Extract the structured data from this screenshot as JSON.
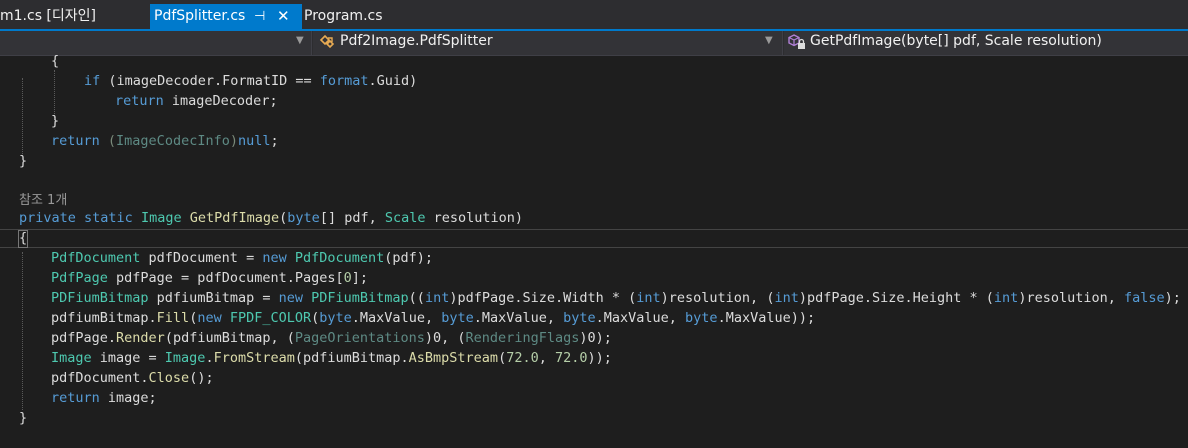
{
  "tabs": [
    {
      "label": "m1.cs [디자인]",
      "active": false
    },
    {
      "label": "PdfSplitter.cs",
      "active": true
    },
    {
      "label": "Program.cs",
      "active": false
    }
  ],
  "tab_pin_glyph": "⊣",
  "tab_close_glyph": "✕",
  "navbar": {
    "namespace_label": "Pdf2Image.PdfSplitter",
    "member_label": "GetPdfImage(byte[] pdf, Scale resolution)"
  },
  "icons": {
    "class_icon": "class-icon",
    "method_icon": "private-method-icon",
    "dropdown": "chevron-down-icon"
  },
  "colors": {
    "background": "#1e1e1e",
    "accent": "#007acc",
    "keyword": "#569cd6",
    "type": "#4ec9b0",
    "method": "#dcdcaa",
    "number": "#b5cea8",
    "text": "#dcdcdc",
    "codelens": "#999999"
  },
  "codelens": "참조 1개",
  "code": {
    "l1_brace": "{",
    "l2_if": "if",
    "l2_rest": " (imageDecoder.FormatID == ",
    "l2_format": "format",
    "l2_end": ".Guid)",
    "l3_return": "return",
    "l3_rest": " imageDecoder;",
    "l4_brace": "}",
    "l5_return": "return",
    "l5_cast_open": " (",
    "l5_type": "ImageCodecInfo",
    "l5_cast_close": ")",
    "l5_null": "null",
    "l5_end": ";",
    "l6_brace": "}",
    "sig_private": "private",
    "sig_static": "static",
    "sig_image": "Image",
    "sig_name": "GetPdfImage",
    "sig_open": "(",
    "sig_byte": "byte",
    "sig_mid": "[] pdf, ",
    "sig_scale": "Scale",
    "sig_end": " resolution)",
    "body_open": "{",
    "b1_t1": "PdfDocument",
    "b1_a": " pdfDocument = ",
    "b1_new": "new",
    "b1_t2": "PdfDocument",
    "b1_b": "(pdf);",
    "b2_t1": "PdfPage",
    "b2_a": " pdfPage = pdfDocument.Pages[",
    "b2_n": "0",
    "b2_b": "];",
    "b3_t1": "PDFiumBitmap",
    "b3_a": " pdfiumBitmap = ",
    "b3_new": "new",
    "b3_t2": "PDFiumBitmap",
    "b3_b": "((",
    "b3_int1": "int",
    "b3_c": ")pdfPage.Size.Width * (",
    "b3_int2": "int",
    "b3_d": ")resolution, (",
    "b3_int3": "int",
    "b3_e": ")pdfPage.Size.Height * (",
    "b3_int4": "int",
    "b3_f": ")resolution, ",
    "b3_false": "false",
    "b3_g": ");",
    "b4_a": "pdfiumBitmap.",
    "b4_fill": "Fill",
    "b4_b": "(",
    "b4_new": "new",
    "b4_ctor": "FPDF_COLOR",
    "b4_c": "(",
    "b4_byte1": "byte",
    "b4_d": ".MaxValue, ",
    "b4_byte2": "byte",
    "b4_e": ".MaxValue, ",
    "b4_byte3": "byte",
    "b4_f": ".MaxValue, ",
    "b4_byte4": "byte",
    "b4_g": ".MaxValue));",
    "b5_a": "pdfPage.",
    "b5_render": "Render",
    "b5_b": "(pdfiumBitmap, (",
    "b5_t1": "PageOrientations",
    "b5_c": ")0, (",
    "b5_t2": "RenderingFlags",
    "b5_d": ")0);",
    "b6_t1": "Image",
    "b6_a": " image = ",
    "b6_t2": "Image",
    "b6_b": ".",
    "b6_fs": "FromStream",
    "b6_c": "(pdfiumBitmap.",
    "b6_abs": "AsBmpStream",
    "b6_d": "(",
    "b6_n1": "72.0",
    "b6_e": ", ",
    "b6_n2": "72.0",
    "b6_f": "));",
    "b7_a": "pdfDocument.",
    "b7_close": "Close",
    "b7_b": "();",
    "b8_return": "return",
    "b8_rest": " image;",
    "body_close": "}"
  }
}
